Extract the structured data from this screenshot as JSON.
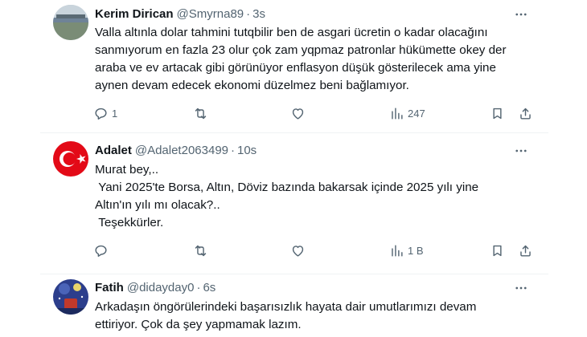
{
  "tweets": [
    {
      "name": "Kerim Dirican",
      "handle": "@Smyrna89",
      "time": "3s",
      "text": "Valla altınla dolar tahmini tutqbilir ben de asgari ücretin o kadar olacağını\nsanmıyorum en fazla 23 olur çok zam yqpmaz patronlar hükümette okey der\naraba ve ev artacak gibi görünüyor enflasyon düşük gösterilecek ama yine\naynen devam edecek ekonomi düzelmez beni bağlamıyor.",
      "replies": "1",
      "retweets": "",
      "likes": "",
      "views": "247"
    },
    {
      "name": "Adalet",
      "handle": "@Adalet2063499",
      "time": "10s",
      "text": "Murat bey,..\n Yani 2025'te Borsa, Altın, Döviz bazında bakarsak içinde 2025 yılı yine\nAltın'ın yılı mı olacak?..\n Teşekkürler.",
      "replies": "",
      "retweets": "",
      "likes": "",
      "views": "1 B"
    },
    {
      "name": "Fatih",
      "handle": "@didayday0",
      "time": "6s",
      "text": "Arkadaşın öngörülerindeki başarısızlık hayata dair umutlarımızı devam\nettiriyor. Çok da şey yapmamak lazım."
    }
  ],
  "colors": {
    "text": "#0f1419",
    "secondary": "#536471",
    "divider": "#eff3f4",
    "flag_red": "#e30a17"
  },
  "icons": [
    "reply-icon",
    "retweet-icon",
    "like-icon",
    "views-icon",
    "bookmark-icon",
    "share-icon",
    "more-icon"
  ]
}
